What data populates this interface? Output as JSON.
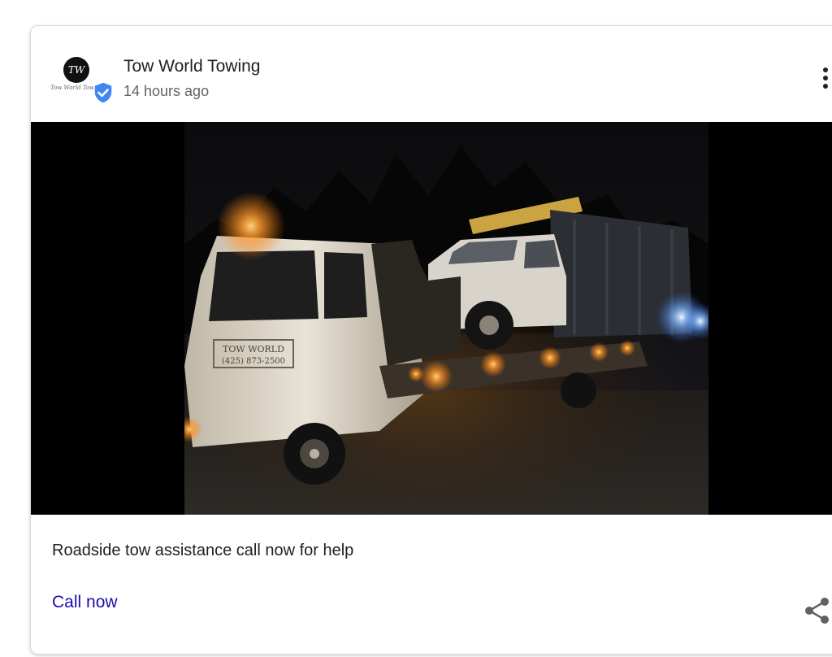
{
  "post": {
    "business_name": "Tow World Towing",
    "time_ago": "14 hours ago",
    "summary": "Roadside tow assistance call now for help",
    "cta_label": "Call now"
  },
  "logo": {
    "monogram": "TW",
    "script_text": "Tow World Towing"
  },
  "photo": {
    "door_line1": "TOW WORLD",
    "door_line2": "(425) 873-2500"
  },
  "icons": {
    "verified": "verified-shield-icon",
    "more": "more-vert-icon",
    "share": "share-icon"
  },
  "colors": {
    "link": "#1a0dab",
    "verified": "#4285f4",
    "text": "#202124",
    "secondary_text": "#5f6368"
  }
}
